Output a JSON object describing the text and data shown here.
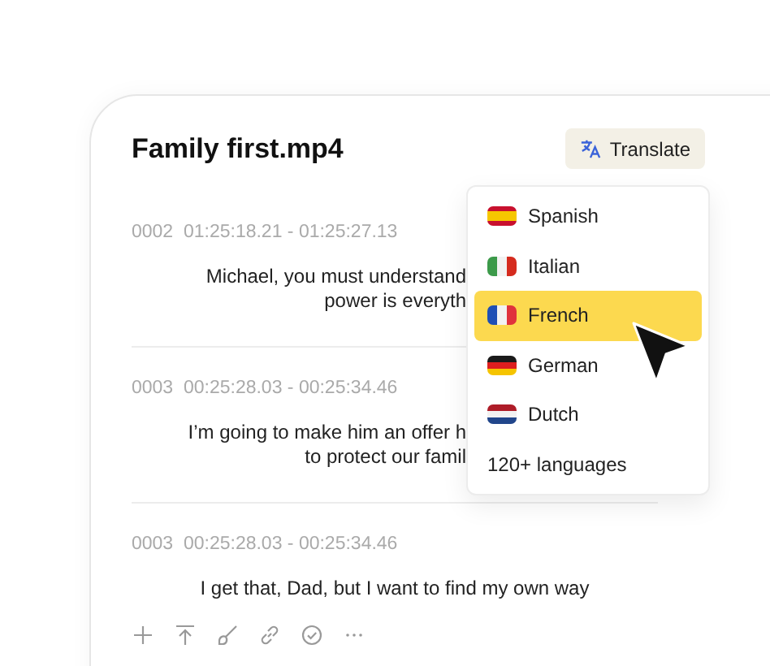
{
  "title": "Family first.mp4",
  "translate_button": {
    "label": "Translate"
  },
  "segments": [
    {
      "timecode": "0002  01:25:18.21 - 01:25:27.13",
      "lines": [
        "Michael, you must understand",
        "power is everyth"
      ],
      "kind": "cut"
    },
    {
      "timecode": "0003  00:25:28.03 - 00:25:34.46",
      "lines": [
        "I’m going to make him an offer h",
        "to protect our famil"
      ],
      "kind": "cut"
    },
    {
      "timecode": "0003  00:25:28.03 - 00:25:34.46",
      "lines": [
        "I get that, Dad, but I want to find my own way"
      ],
      "kind": "full"
    }
  ],
  "languages": [
    {
      "label": "Spanish",
      "kind": "es",
      "selected": false
    },
    {
      "label": "Italian",
      "kind": "it",
      "selected": false
    },
    {
      "label": "French",
      "kind": "fr",
      "selected": true
    },
    {
      "label": "German",
      "kind": "de",
      "selected": false
    },
    {
      "label": "Dutch",
      "kind": "nl",
      "selected": false
    },
    {
      "label": "120+ languages",
      "kind": "more",
      "selected": false
    }
  ],
  "toolbar": [
    {
      "kind": "plus"
    },
    {
      "kind": "upload"
    },
    {
      "kind": "brush"
    },
    {
      "kind": "link"
    },
    {
      "kind": "check"
    },
    {
      "kind": "more"
    }
  ]
}
